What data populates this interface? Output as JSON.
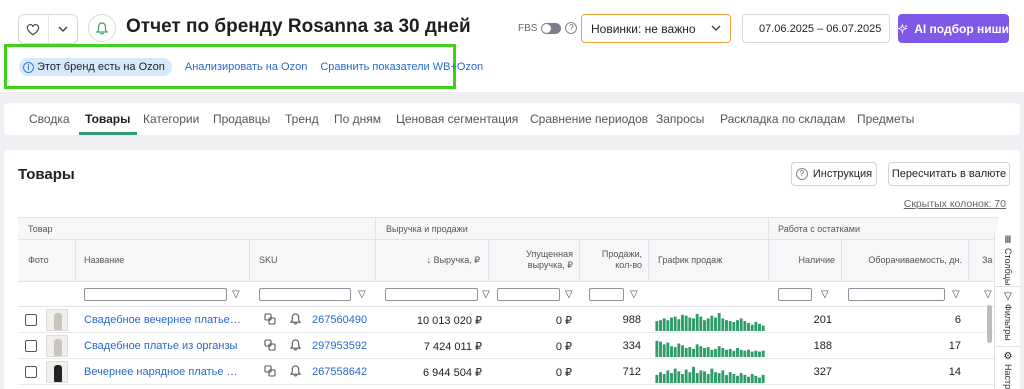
{
  "header": {
    "title": "Отчет по бренду Rosanna за 30 дней",
    "fbs_label": "FBS",
    "news_select": "Новинки: не важно",
    "date_range": "07.06.2025 – 06.07.2025",
    "ai_button": "AI подбор ниши"
  },
  "ozon": {
    "badge": "Этот бренд есть на Ozon",
    "analyze_link": "Анализировать на Ozon",
    "compare_link": "Сравнить показатели WB+Ozon"
  },
  "tabs": [
    {
      "label": "Сводка"
    },
    {
      "label": "Товары",
      "active": true
    },
    {
      "label": "Категории"
    },
    {
      "label": "Продавцы"
    },
    {
      "label": "Тренд"
    },
    {
      "label": "По дням"
    },
    {
      "label": "Ценовая сегментация"
    },
    {
      "label": "Сравнение периодов"
    },
    {
      "label": "Запросы"
    },
    {
      "label": "Раскладка по складам"
    },
    {
      "label": "Предметы"
    }
  ],
  "panel": {
    "title": "Товары",
    "instruction_button": "Инструкция",
    "currency_button": "Пересчитать в валюте",
    "hidden_columns": "Скрытых колонок: 70"
  },
  "table": {
    "groups": {
      "product": "Товар",
      "revenue": "Выручка и продажи",
      "stock": "Работа с остатками"
    },
    "columns": {
      "photo": "Фото",
      "name": "Название",
      "sku": "SKU",
      "revenue": "↓ Выручка, ₽",
      "lost_revenue_1": "Упущенная",
      "lost_revenue_2": "выручка, ₽",
      "sales_1": "Продажи,",
      "sales_2": "кол-во",
      "sales_chart": "График продаж",
      "stock": "Наличие",
      "turnover": "Оборачиваемость, дн.",
      "extra": "Зa"
    },
    "rows": [
      {
        "name": "Свадебное вечернее платье в по...",
        "sku": "267560490",
        "revenue": "10 013 020 ₽",
        "lost": "0 ₽",
        "sales": "988",
        "stock": "201",
        "turnover": "6",
        "dark": false,
        "spark": [
          0.55,
          0.6,
          0.7,
          0.6,
          0.75,
          0.8,
          0.65,
          0.9,
          0.85,
          0.75,
          0.7,
          0.95,
          0.8,
          0.6,
          0.7,
          0.85,
          0.75,
          1.0,
          0.7,
          0.6,
          0.55,
          0.5,
          0.6,
          0.7,
          0.55,
          0.45,
          0.35,
          0.5,
          0.4,
          0.3
        ]
      },
      {
        "name": "Свадебное платье из органзы",
        "sku": "297953592",
        "revenue": "7 424 011 ₽",
        "lost": "0 ₽",
        "sales": "334",
        "stock": "188",
        "turnover": "17",
        "dark": false,
        "spark": [
          0.9,
          0.85,
          0.7,
          0.8,
          0.6,
          0.55,
          0.75,
          0.65,
          0.5,
          0.55,
          0.45,
          0.7,
          0.6,
          0.5,
          0.55,
          0.4,
          0.45,
          0.6,
          0.5,
          0.4,
          0.45,
          0.35,
          0.5,
          0.4,
          0.35,
          0.4,
          0.3,
          0.35,
          0.3,
          0.35
        ]
      },
      {
        "name": "Вечернее нарядное платье для в...",
        "sku": "267558642",
        "revenue": "6 944 504 ₽",
        "lost": "0 ₽",
        "sales": "712",
        "stock": "327",
        "turnover": "14",
        "dark": true,
        "spark": [
          0.45,
          0.6,
          0.5,
          0.7,
          0.55,
          0.8,
          0.65,
          0.5,
          0.75,
          0.6,
          0.9,
          0.55,
          0.7,
          0.65,
          0.5,
          0.8,
          0.6,
          0.55,
          0.7,
          0.45,
          0.6,
          0.5,
          0.4,
          0.55,
          0.45,
          0.35,
          0.5,
          0.4,
          0.3,
          0.45
        ]
      }
    ]
  },
  "sidebar": {
    "columns": "Столбцы",
    "filters": "Фильтры",
    "settings": "Настр"
  },
  "colors": {
    "accent_purple": "#7e58e6",
    "highlight_green": "#3dd11b",
    "tab_active": "#2a9d6b",
    "link_blue": "#2a68c9",
    "spark_green": "#2e9b6a",
    "select_border": "#f2a23a"
  }
}
